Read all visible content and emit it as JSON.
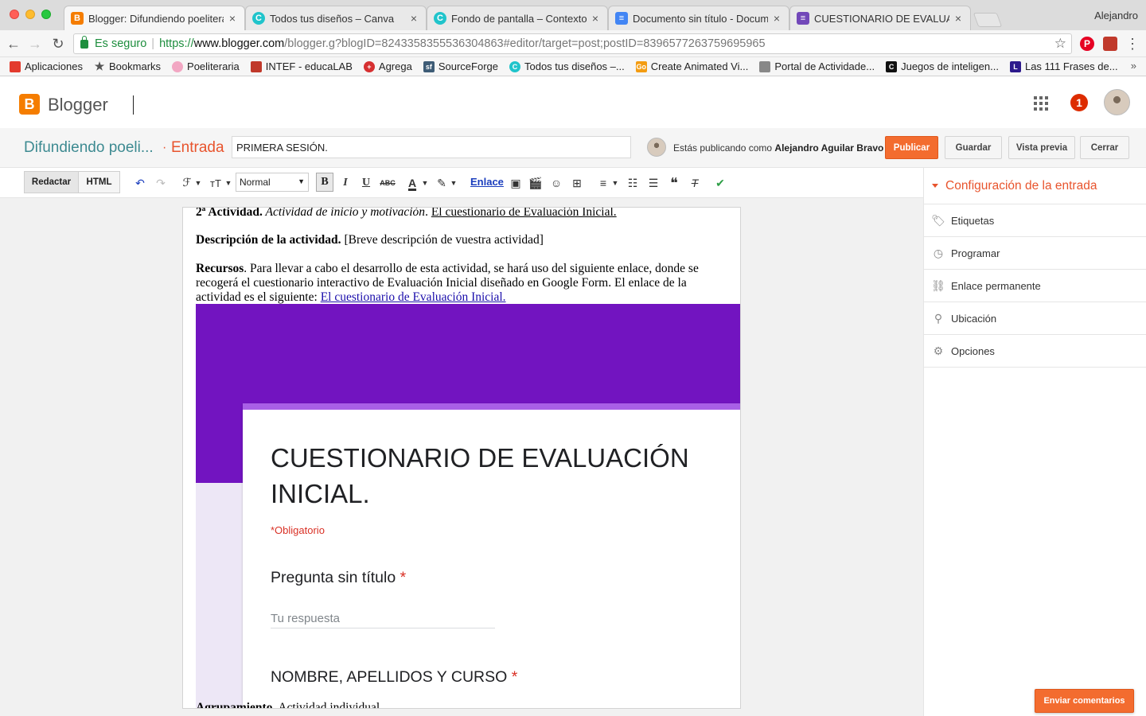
{
  "browser": {
    "profile_name": "Alejandro",
    "tabs": [
      {
        "title": "Blogger: Difundiendo poeliteraria",
        "icon": "blogger-icon",
        "color": "#f57d00",
        "active": true
      },
      {
        "title": "Todos tus diseños – Canva",
        "icon": "canva-icon",
        "color": "#20c4cb",
        "active": false
      },
      {
        "title": "Fondo de pantalla – Contexto I",
        "icon": "canva-icon",
        "color": "#20c4cb",
        "active": false
      },
      {
        "title": "Documento sin título - Documentos",
        "icon": "docs-icon",
        "color": "#4285f4",
        "active": false
      },
      {
        "title": "CUESTIONARIO DE EVALUACIÓN",
        "icon": "forms-icon",
        "color": "#7248b9",
        "active": false
      }
    ],
    "tab_close_glyph": "×",
    "address": {
      "secure_label": "Es seguro",
      "scheme": "https://",
      "host": "www.blogger.com",
      "path": "/blogger.g?blogID=8243358355536304863#editor/target=post;postID=8396577263759695965"
    },
    "bookmarks": [
      {
        "label": "Aplicaciones",
        "icon": "apps-grid-icon",
        "color": "#e33b2e"
      },
      {
        "label": "Bookmarks",
        "icon": "star-icon",
        "color": "#555555"
      },
      {
        "label": "Poeliteraria",
        "icon": "flower-icon",
        "color": "#f2a7c3"
      },
      {
        "label": "INTEF - educaLAB",
        "icon": "intef-icon",
        "color": "#c0392b"
      },
      {
        "label": "Agrega",
        "icon": "agrega-icon",
        "color": "#d63031"
      },
      {
        "label": "SourceForge",
        "icon": "sourceforge-icon",
        "color": "#3e5c76"
      },
      {
        "label": "Todos tus diseños –...",
        "icon": "canva-icon",
        "color": "#20c4cb"
      },
      {
        "label": "Create Animated Vi...",
        "icon": "goanimate-icon",
        "color": "#f39c12"
      },
      {
        "label": "Portal de Actividade...",
        "icon": "portal-icon",
        "color": "#888888"
      },
      {
        "label": "Juegos de inteligen...",
        "icon": "c-icon",
        "color": "#111111"
      },
      {
        "label": "Las 111 Frases de...",
        "icon": "l-icon",
        "color": "#2d1a8c"
      }
    ],
    "bookmarks_overflow": "»"
  },
  "blogger": {
    "app_name": "Blogger",
    "logo_letter": "B",
    "notification_count": "1",
    "blog_title": "Difundiendo poeli...",
    "separator": "·",
    "entry_label": "Entrada",
    "post_title_value": "PRIMERA SESIÓN.",
    "publishing_as_prefix": "Estás publicando como ",
    "publishing_as_name": "Alejandro Aguilar Bravo",
    "buttons": {
      "publish": "Publicar",
      "save": "Guardar",
      "preview": "Vista previa",
      "close": "Cerrar"
    }
  },
  "toolbar": {
    "compose": "Redactar",
    "html": "HTML",
    "format_value": "Normal",
    "bold": "B",
    "italic": "I",
    "underline": "U",
    "strike": "ABC",
    "link": "Enlace",
    "undo": "↶",
    "redo": "↷",
    "font": "ℱ",
    "size": "тT",
    "text_color": "A",
    "quote": "❝"
  },
  "content": {
    "activity_line_bold": "2ª Actividad.",
    "activity_line_italic": " Actividad de inicio y motivación",
    "activity_line_link": "El cuestionario de Evaluación Inicial.",
    "description_bold": "Descripción de la actividad.",
    "description_text": " [Breve descripción de vuestra actividad]",
    "resources_bold": "Recursos",
    "resources_text": ". Para llevar a cabo el desarrollo de esta actividad, se hará uso del siguiente enlace, donde se recogerá el cuestionario interactivo de Evaluación Inicial diseñado en Google Form. El enlace de la actividad es el siguiente: ",
    "resources_link": "El cuestionario de Evaluación Inicial.",
    "bottom_bold": "Agrupamiento",
    "bottom_text": ". Actividad individual",
    "form": {
      "title": "CUESTIONARIO DE EVALUACIÓN INICIAL.",
      "required_note": "*Obligatorio",
      "question_1": "Pregunta sin título",
      "answer_placeholder": "Tu respuesta",
      "question_2": "NOMBRE, APELLIDOS Y CURSO",
      "required_mark": "*",
      "hero_color": "#7214c0",
      "accent_color": "#a860e6"
    }
  },
  "right_panel": {
    "header": "Configuración de la entrada",
    "items": [
      {
        "label": "Etiquetas",
        "icon": "tag-icon"
      },
      {
        "label": "Programar",
        "icon": "clock-icon"
      },
      {
        "label": "Enlace permanente",
        "icon": "link-icon"
      },
      {
        "label": "Ubicación",
        "icon": "location-pin-icon"
      },
      {
        "label": "Opciones",
        "icon": "gear-icon"
      }
    ]
  },
  "feedback_button": "Enviar comentarios",
  "colors": {
    "blogger_orange": "#f36c2f",
    "blog_title_teal": "#3d8a91",
    "accent_red": "#e8542d"
  }
}
